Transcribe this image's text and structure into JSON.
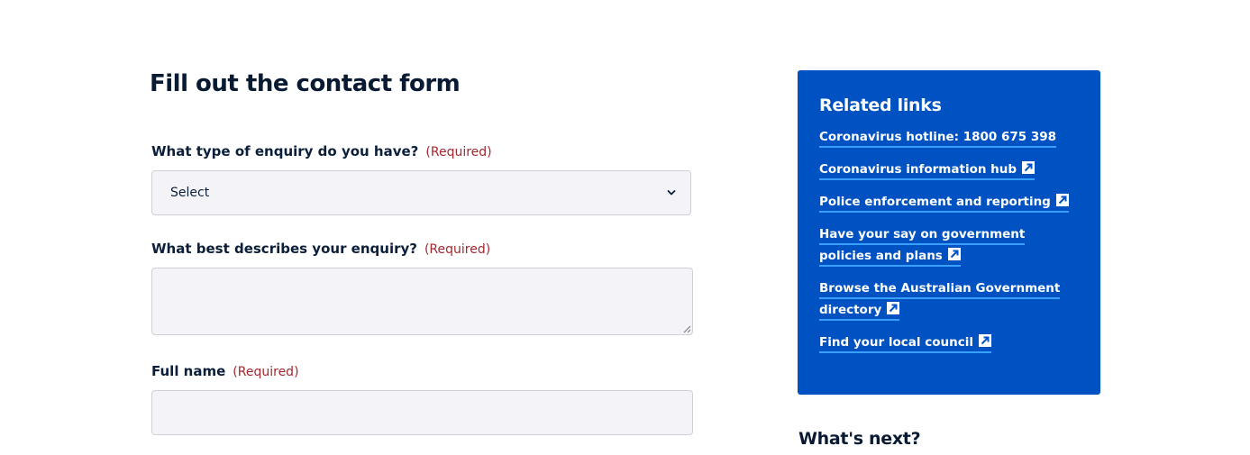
{
  "main": {
    "title": "Fill out the contact form",
    "fields": [
      {
        "label": "What type of enquiry do you have?",
        "required_text": "(Required)",
        "type": "select",
        "value": "Select"
      },
      {
        "label": "What best describes your enquiry?",
        "required_text": "(Required)",
        "type": "textarea",
        "value": ""
      },
      {
        "label": "Full name",
        "required_text": "(Required)",
        "type": "text",
        "value": ""
      }
    ]
  },
  "sidebar": {
    "title": "Related links",
    "links": [
      {
        "label": "Coronavirus hotline: 1800 675 398",
        "external": false
      },
      {
        "label": "Coronavirus information hub",
        "external": true
      },
      {
        "label": "Police enforcement and reporting",
        "external": true
      },
      {
        "label": "Have your say on government policies and plans",
        "external": true
      },
      {
        "label": "Browse the Australian Government directory",
        "external": true
      },
      {
        "label": "Find your local council",
        "external": true
      }
    ],
    "external_icon": "external-link-icon"
  },
  "next_section": {
    "title": "What's next?"
  },
  "colors": {
    "panel_background": "#0052c2",
    "link_underline": "#3aa0ff",
    "required_text": "#a4282f",
    "heading": "#091a33",
    "field_background": "#f4f4f8"
  }
}
